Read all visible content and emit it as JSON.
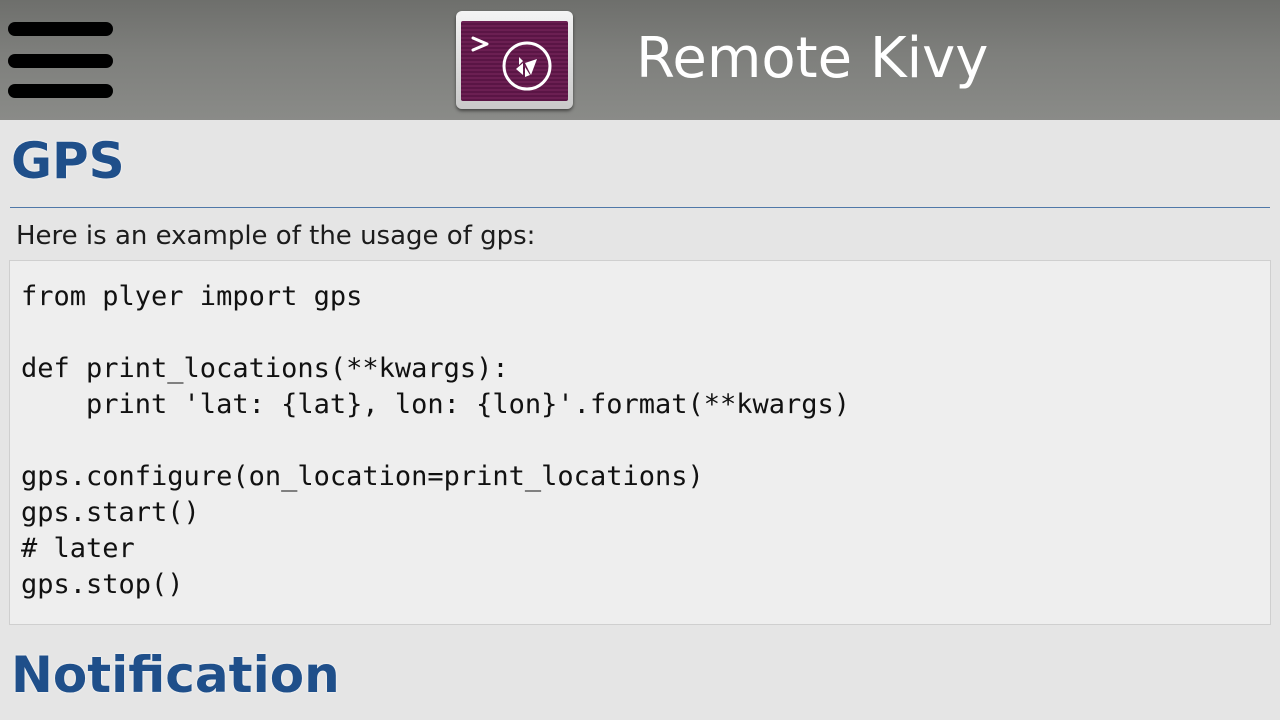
{
  "header": {
    "menu_icon": "hamburger-menu-icon",
    "app_icon": "kivy-terminal-logo-icon",
    "title": "Remote Kivy"
  },
  "section_gps": {
    "heading": "GPS",
    "intro": "Here is an example of the usage of gps:",
    "code": "from plyer import gps\n\ndef print_locations(**kwargs):\n    print 'lat: {lat}, lon: {lon}'.format(**kwargs)\n\ngps.configure(on_location=print_locations)\ngps.start()\n# later\ngps.stop()"
  },
  "section_notification": {
    "heading": "Notification"
  },
  "colors": {
    "heading": "#1f4f8a",
    "topbar": "#7a7b78",
    "background": "#e5e5e5",
    "code_background": "#eeeeee"
  }
}
